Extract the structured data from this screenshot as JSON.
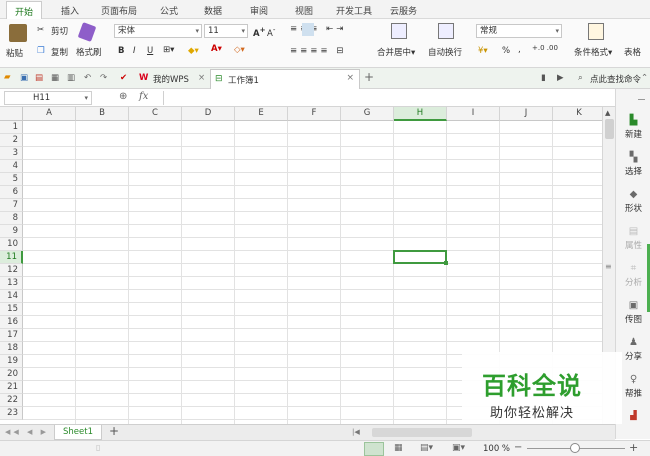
{
  "menu": {
    "tabs": [
      "开始",
      "插入",
      "页面布局",
      "公式",
      "数据",
      "审阅",
      "视图",
      "开发工具",
      "云服务"
    ]
  },
  "ribbon": {
    "paste": "粘贴",
    "cut": "剪切",
    "copy": "复制",
    "format_painter": "格式刷",
    "font_name": "宋体",
    "font_size": "11",
    "bold": "B",
    "italic": "I",
    "underline": "U",
    "merge_center": "合并居中",
    "wrap_text": "自动换行",
    "number_format": "常规",
    "percent": "%",
    "comma": ",",
    "cond_format": "条件格式",
    "table_style": "表格"
  },
  "tabbar": {
    "my_wps": "我的WPS",
    "workbook": "工作簿1",
    "search": "点此查找命令"
  },
  "formula": {
    "cell_ref": "H11",
    "fx": "fx",
    "value": ""
  },
  "grid": {
    "columns": [
      "A",
      "B",
      "C",
      "D",
      "E",
      "F",
      "G",
      "H",
      "I",
      "J",
      "K"
    ],
    "rows": [
      "1",
      "2",
      "3",
      "4",
      "5",
      "6",
      "7",
      "8",
      "9",
      "10",
      "11",
      "12",
      "13",
      "14",
      "15",
      "16",
      "17",
      "18",
      "19",
      "20",
      "21",
      "22",
      "23"
    ],
    "active_column": "H",
    "active_row": "11"
  },
  "side": {
    "new": "新建",
    "select": "选择",
    "shape": "形状",
    "property": "属性",
    "analysis": "分析",
    "image": "传图",
    "share": "分享",
    "help": "帮推"
  },
  "sheets": {
    "tabs": [
      "Sheet1"
    ],
    "add": "+"
  },
  "status": {
    "zoom": "100 %"
  },
  "watermark": {
    "title": "百科全说",
    "subtitle": "助你轻松解决"
  },
  "colors": {
    "accent": "#1f7a1f",
    "wps_red": "#d9001b"
  }
}
